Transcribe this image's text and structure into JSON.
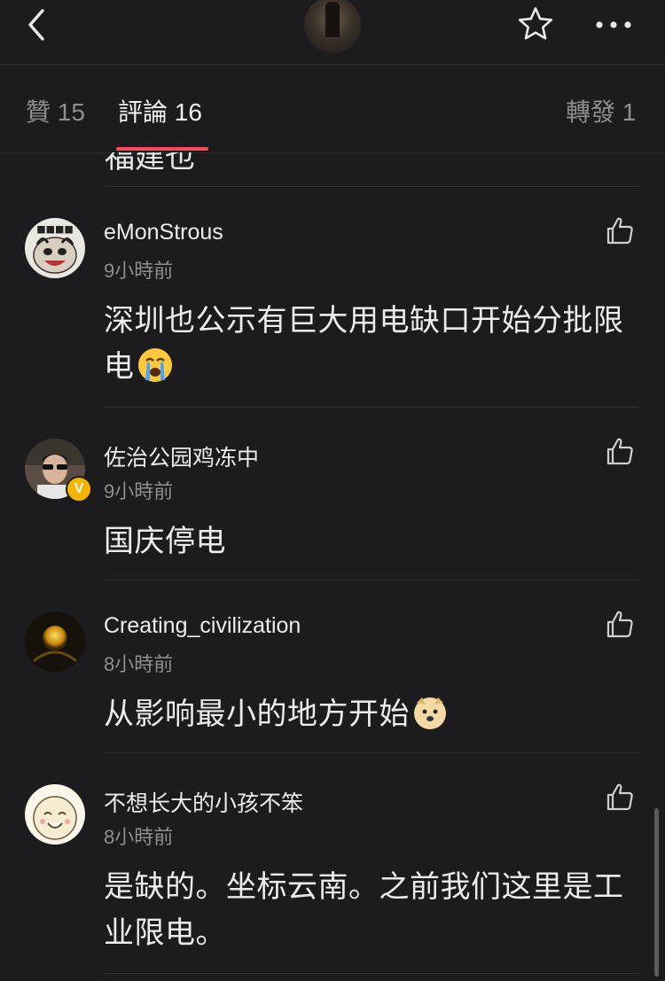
{
  "tabs": [
    {
      "label": "贊 15",
      "active": false
    },
    {
      "label": "評論 16",
      "active": true
    },
    {
      "label": "轉發 1",
      "active": false
    }
  ],
  "partial_previous_comment": "福建也",
  "comments": [
    {
      "username": "eMonStrous",
      "time": "9小時前",
      "text": "深圳也公示有巨大用电缺口开始分批限电",
      "emoji": "loudly-crying-face",
      "avatar": "tiger-cartoon-avatar"
    },
    {
      "username": "佐治公园鸡冻中",
      "time": "9小時前",
      "text": "国庆停电",
      "verified_badge": "V",
      "avatar": "man-sunglasses-avatar"
    },
    {
      "username": "Creating_civilization",
      "time": "8小時前",
      "text": "从影响最小的地方开始",
      "emoji": "doge-face",
      "avatar": "glowing-orb-avatar"
    },
    {
      "username": "不想长大的小孩不笨",
      "time": "8小時前",
      "text": "是缺的。坐标云南。之前我们这里是工业限电。",
      "avatar": "smiling-bun-cartoon-avatar"
    }
  ],
  "icons": {
    "back": "chevron-left-icon",
    "favorite": "star-icon",
    "more": "more-dots-icon",
    "like": "thumbs-up-outline-icon"
  },
  "colors": {
    "background": "#1c1c1e",
    "tab_indicator": "#ff4a5d",
    "verified": "#f5b400"
  }
}
